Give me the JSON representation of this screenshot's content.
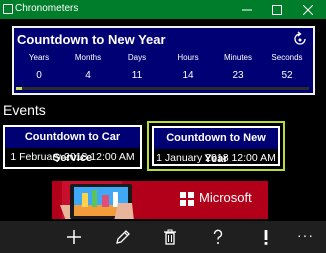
{
  "window": {
    "title": "Chronometers"
  },
  "countdown": {
    "title": "Countdown to New Year",
    "units": [
      {
        "label": "Years",
        "value": "0"
      },
      {
        "label": "Months",
        "value": "4"
      },
      {
        "label": "Days",
        "value": "11"
      },
      {
        "label": "Hours",
        "value": "14"
      },
      {
        "label": "Minutes",
        "value": "23"
      },
      {
        "label": "Seconds",
        "value": "52"
      }
    ],
    "progress_fraction": 0.02
  },
  "events": {
    "heading": "Events",
    "items": [
      {
        "name": "Countdown to Car Service",
        "date": "1 February 2018 12:00 AM",
        "selected": false
      },
      {
        "name": "Countdown to New Year",
        "date": "1 January 2018 12:00 AM",
        "selected": true
      }
    ]
  },
  "ad": {
    "brand": "Microsoft"
  },
  "appbar": {
    "icons": [
      "add-icon",
      "edit-icon",
      "delete-icon",
      "help-icon",
      "alert-icon",
      "more-icon"
    ],
    "more_label": "···"
  },
  "colors": {
    "titlebar": "#007d2a",
    "panel": "#000075",
    "accent": "#b9de3c",
    "ad": "#b3001a",
    "appbar": "#1f1f1f"
  }
}
